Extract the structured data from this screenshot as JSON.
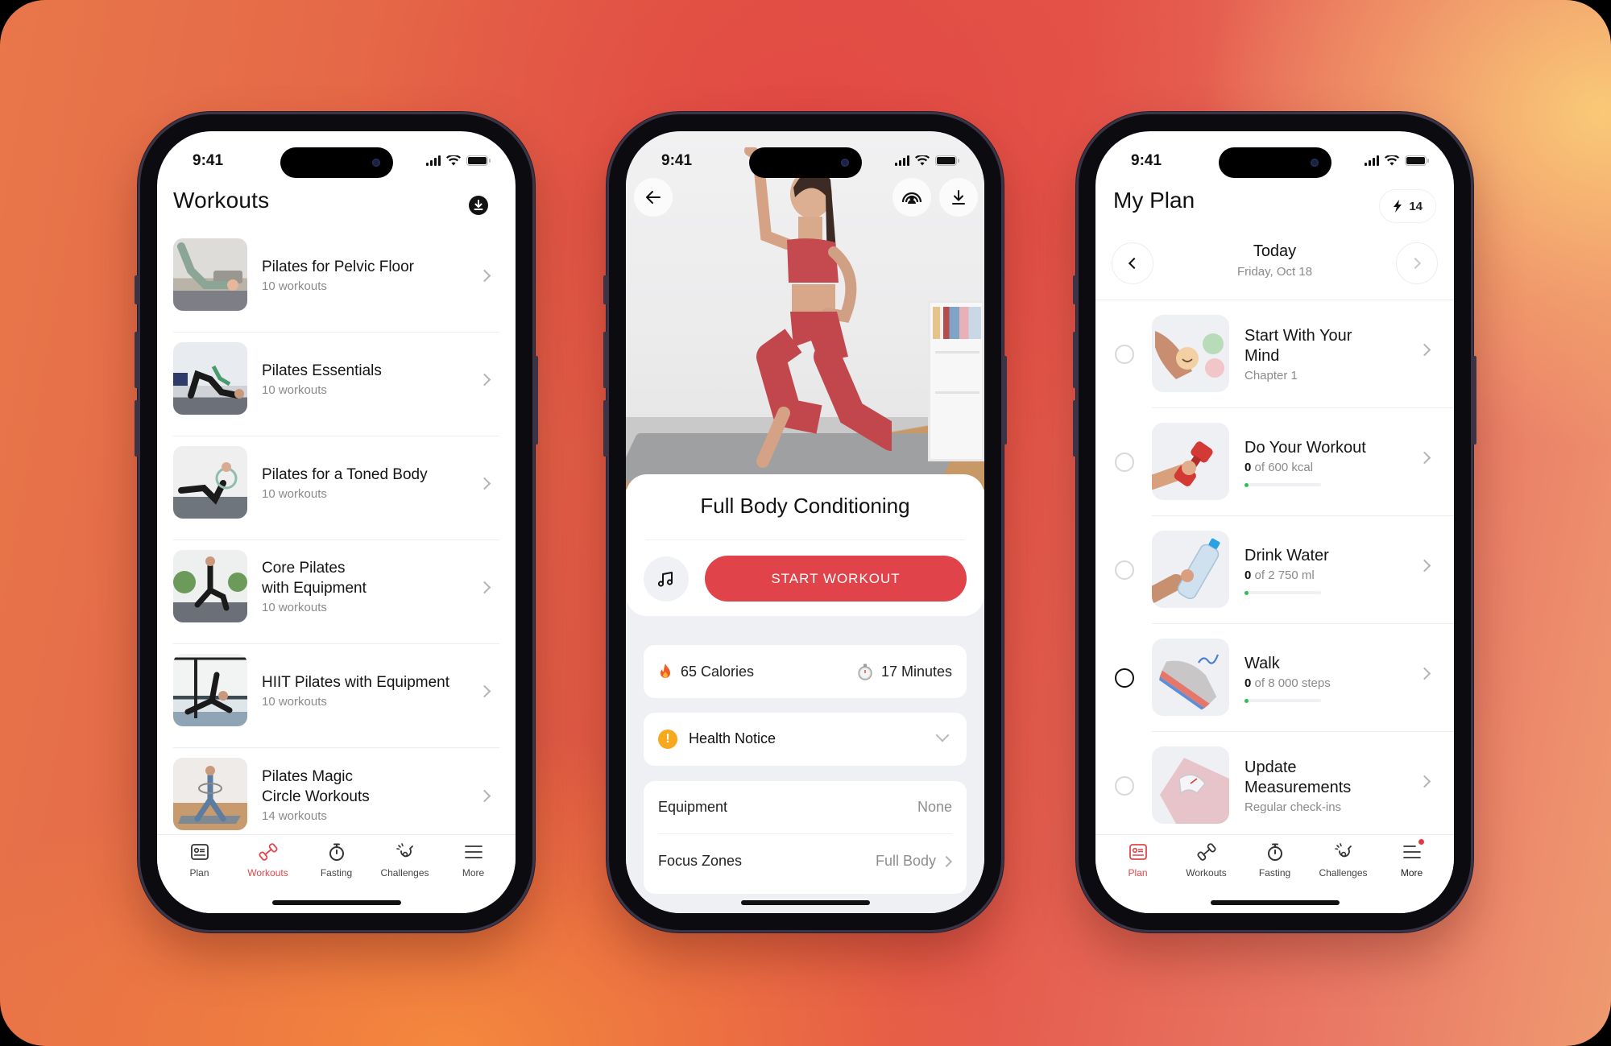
{
  "status_bar": {
    "time": "9:41"
  },
  "workouts_screen": {
    "title": "Workouts",
    "download_icon": "download-circle-icon",
    "items": [
      {
        "name": "Pilates for Pelvic Floor",
        "count": "10 workouts"
      },
      {
        "name": "Pilates Essentials",
        "count": "10 workouts"
      },
      {
        "name": "Pilates for a Toned Body",
        "count": "10 workouts"
      },
      {
        "name": "Core Pilates\nwith Equipment",
        "count": "10 workouts"
      },
      {
        "name": "HIIT Pilates with Equipment",
        "count": "10 workouts"
      },
      {
        "name": "Pilates Magic\nCircle Workouts",
        "count": "14 workouts"
      }
    ],
    "active_tab": "Workouts"
  },
  "workout_detail_screen": {
    "title": "Full Body Conditioning",
    "start_button": "START WORKOUT",
    "calories": "65 Calories",
    "duration": "17 Minutes",
    "health_notice": "Health Notice",
    "details": [
      {
        "label": "Equipment",
        "value": "None"
      },
      {
        "label": "Focus Zones",
        "value": "Full Body"
      }
    ]
  },
  "plan_screen": {
    "title": "My Plan",
    "streak_count": "14",
    "day_label": "Today",
    "day_date": "Friday, Oct 18",
    "items": [
      {
        "name": "Start With Your\nMind",
        "sub": "Chapter 1"
      },
      {
        "name": "Do Your Workout",
        "sub_value": "0",
        "sub_rest": " of 600 kcal",
        "progress": 0
      },
      {
        "name": "Drink Water",
        "sub_value": "0",
        "sub_rest": " of 2 750 ml",
        "progress": 0
      },
      {
        "name": "Walk",
        "sub_value": "0",
        "sub_rest": " of 8 000 steps",
        "progress": 0
      },
      {
        "name": "Update\nMeasurements",
        "sub": "Regular check-ins"
      }
    ],
    "active_tab": "Plan",
    "more_has_badge": true
  },
  "tabs": [
    {
      "label": "Plan",
      "icon": "plan-card-icon"
    },
    {
      "label": "Workouts",
      "icon": "dumbbell-icon"
    },
    {
      "label": "Fasting",
      "icon": "stopwatch-icon"
    },
    {
      "label": "Challenges",
      "icon": "challenge-trophy-icon"
    },
    {
      "label": "More",
      "icon": "hamburger-menu-icon"
    }
  ],
  "colors": {
    "accent": "#e0434a",
    "progress": "#2fbf4d",
    "warning": "#f7a81c"
  }
}
